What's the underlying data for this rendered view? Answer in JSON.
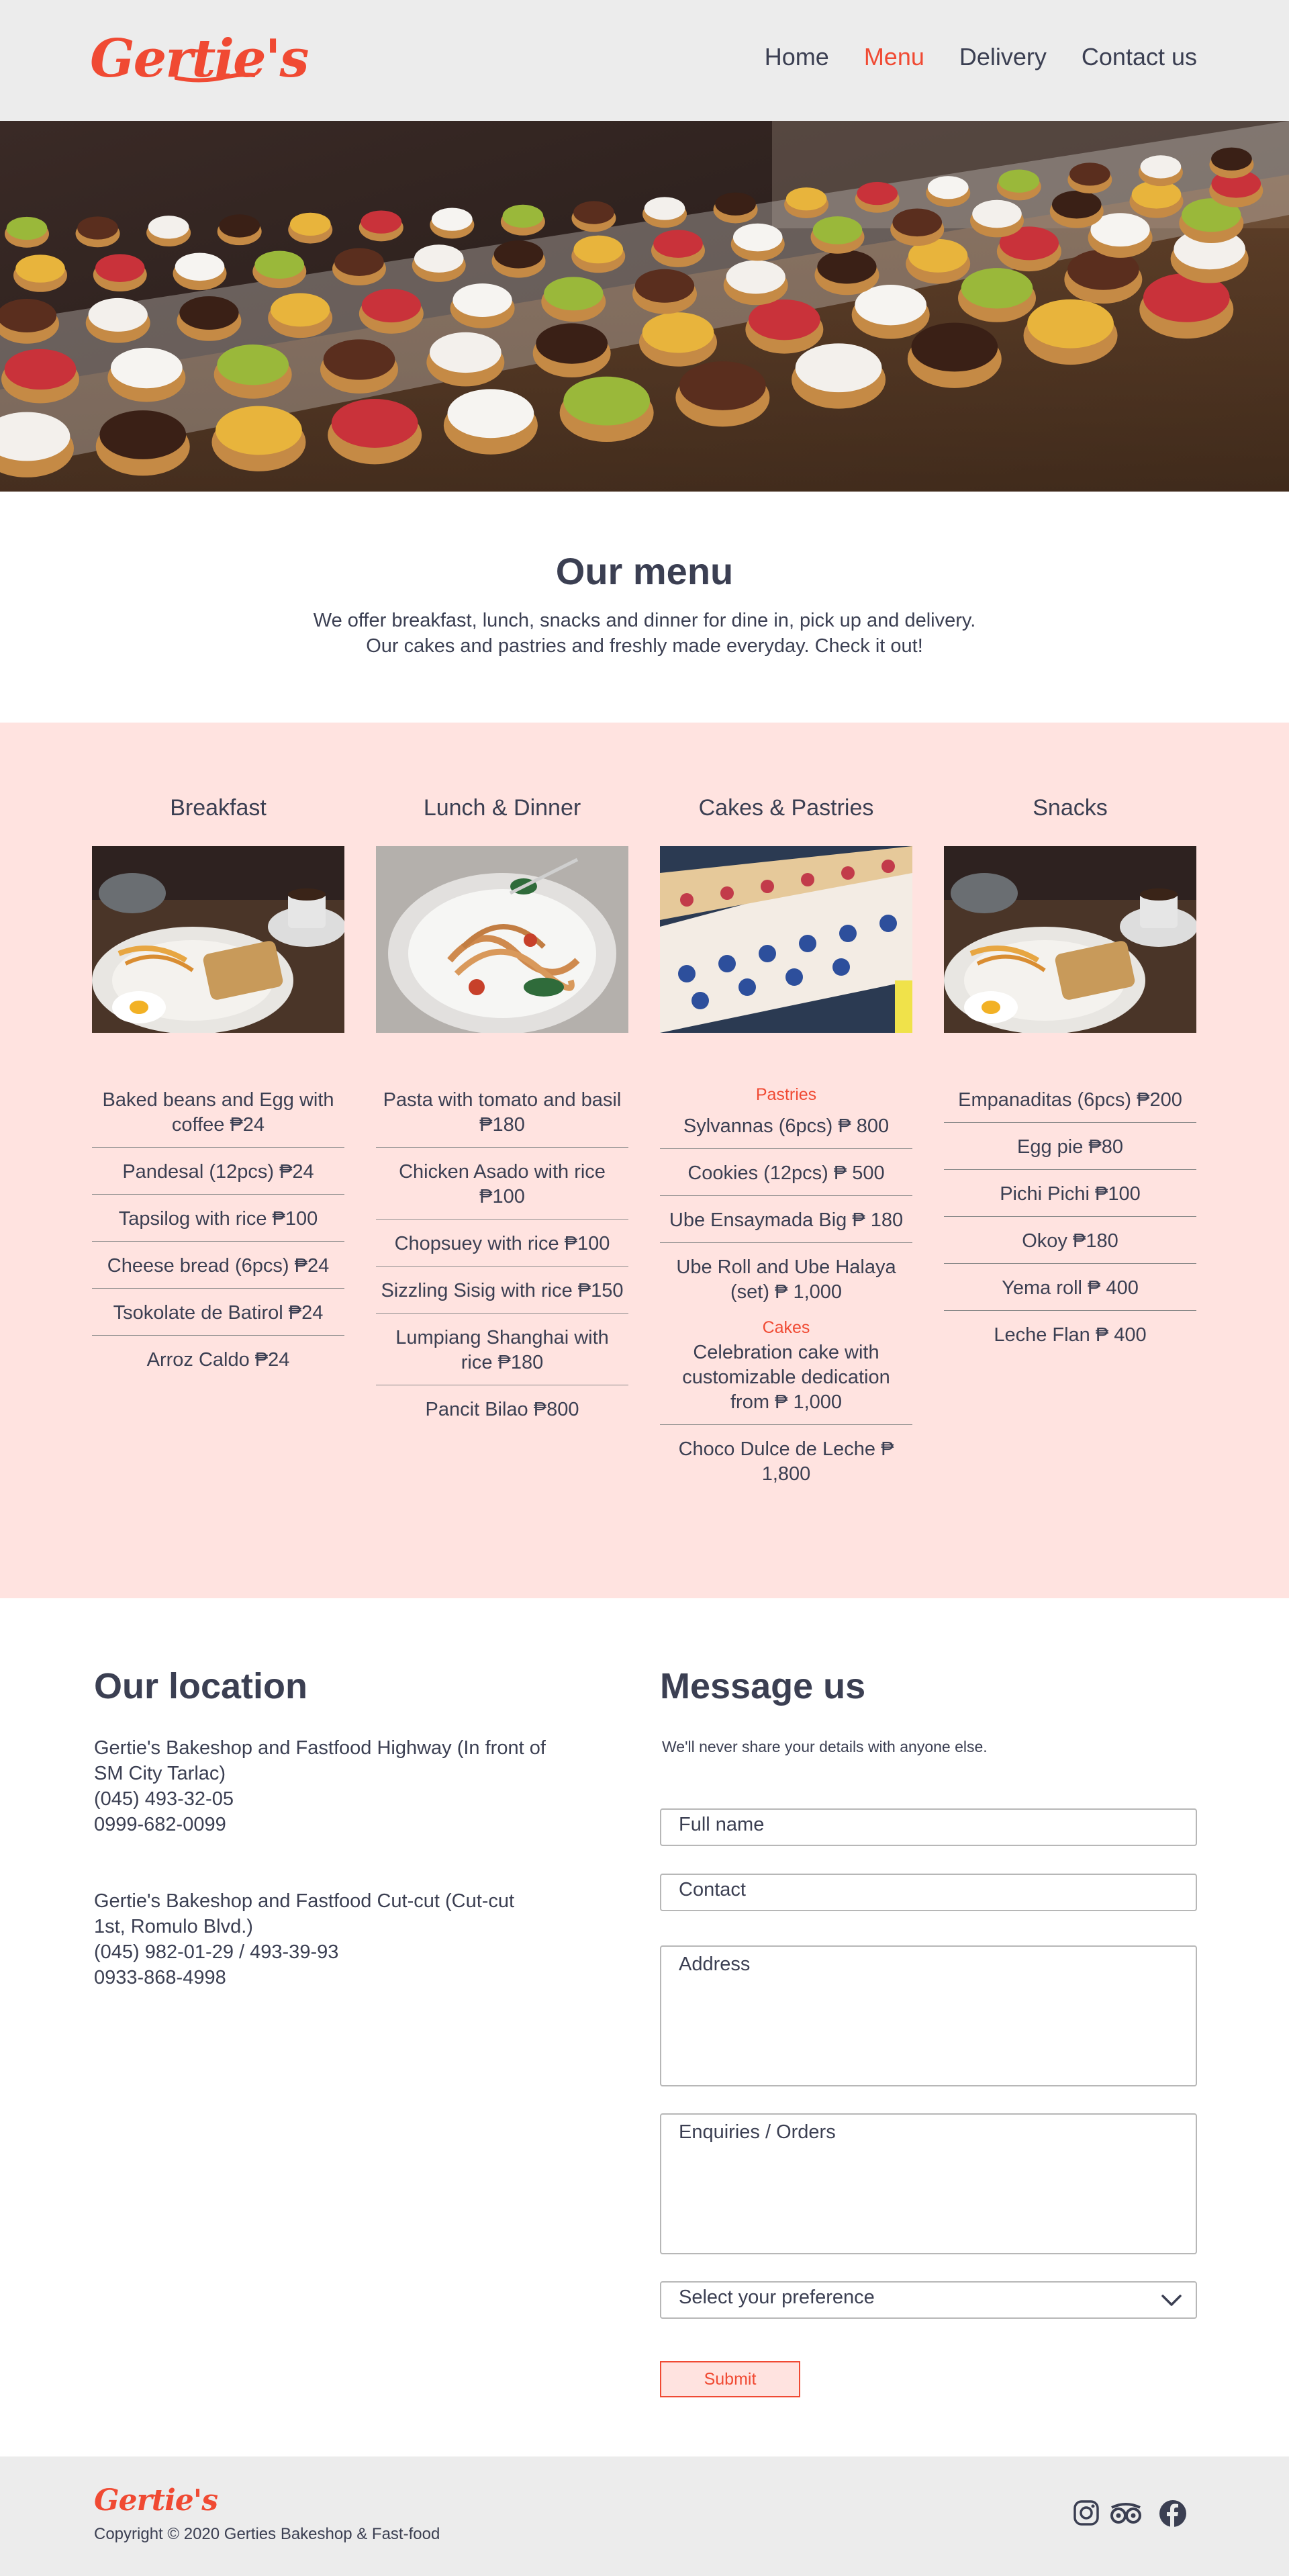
{
  "header": {
    "logo": "Gertie's",
    "nav": [
      "Home",
      "Menu",
      "Delivery",
      "Contact us"
    ]
  },
  "intro": {
    "title": "Our menu",
    "line1": "We offer breakfast, lunch, snacks and dinner for dine in, pick up and delivery.",
    "line2": "Our cakes and pastries and freshly made everyday. Check it out!"
  },
  "menu": {
    "breakfast": {
      "title": "Breakfast",
      "items": [
        "Baked beans and Egg with coffee ₱24",
        "Pandesal (12pcs) ₱24",
        "Tapsilog with rice ₱100",
        "Cheese bread (6pcs) ₱24",
        "Tsokolate de Batirol ₱24",
        "Arroz Caldo ₱24"
      ]
    },
    "lunch": {
      "title": "Lunch & Dinner",
      "items": [
        "Pasta with tomato and basil ₱180",
        "Chicken Asado with rice ₱100",
        "Chopsuey with rice ₱100",
        "Sizzling Sisig with rice ₱150",
        "Lumpiang Shanghai with rice ₱180",
        "Pancit Bilao ₱800"
      ]
    },
    "cakes": {
      "title": "Cakes & Pastries",
      "pastries_label": "Pastries",
      "pastries": [
        "Sylvannas (6pcs) ₱ 800",
        "Cookies (12pcs) ₱ 500",
        "Ube Ensaymada Big ₱ 180",
        "Ube Roll and Ube Halaya (set) ₱ 1,000"
      ],
      "cakes_label": "Cakes",
      "cakes": [
        "Celebration cake with customizable dedication from ₱ 1,000",
        "Choco Dulce de Leche ₱ 1,800"
      ]
    },
    "snacks": {
      "title": "Snacks",
      "items": [
        "Empanaditas (6pcs) ₱200",
        "Egg pie ₱80",
        "Pichi Pichi ₱100",
        "Okoy ₱180",
        "Yema roll ₱ 400",
        "Leche Flan ₱ 400"
      ]
    }
  },
  "location": {
    "title": "Our location",
    "branch1": {
      "name": "Gertie's Bakeshop and Fastfood Highway (In front of SM City Tarlac)",
      "phone": "(045) 493-32-05",
      "mobile": "0999-682-0099"
    },
    "branch2": {
      "name": "Gertie's Bakeshop and Fastfood Cut-cut (Cut-cut 1st, Romulo Blvd.)",
      "phone": "(045) 982-01-29 / 493-39-93",
      "mobile": "0933-868-4998"
    }
  },
  "message": {
    "title": "Message us",
    "note": "We'll never share your details with anyone else.",
    "fullname_placeholder": "Full name",
    "contact_placeholder": "Contact",
    "address_placeholder": "Address",
    "enquiries_placeholder": "Enquiries / Orders",
    "select_value": "Select your preference",
    "submit_label": "Submit"
  },
  "footer": {
    "logo": "Gertie's",
    "copyright": "Copyright © 2020 Gerties Bakeshop & Fast-food",
    "icons": [
      "instagram-icon",
      "tripadvisor-icon",
      "facebook-icon"
    ]
  },
  "colors": {
    "accent": "#f04a33",
    "text": "#3b3f52",
    "menu_bg": "#ffe3e0",
    "header_bg": "#ececec"
  }
}
